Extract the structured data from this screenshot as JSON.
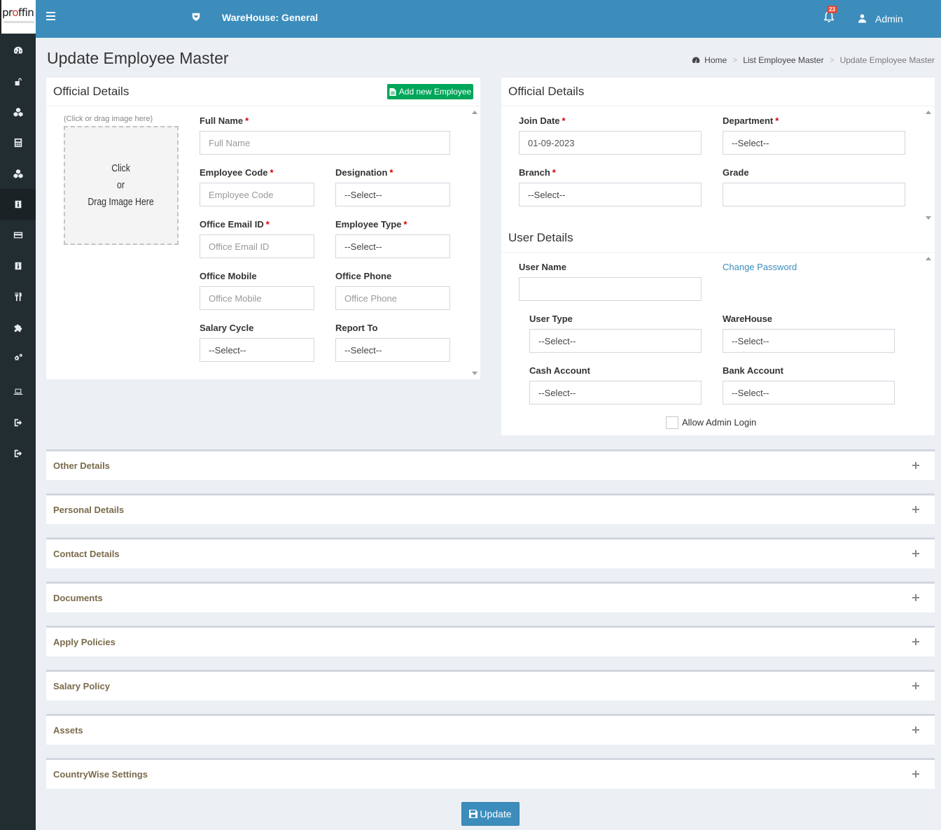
{
  "brand": {
    "logo": "proffin"
  },
  "sidebar": {
    "items": [
      {
        "icon": "dashboard-icon"
      },
      {
        "icon": "unlock-icon"
      },
      {
        "icon": "cubes-icon"
      },
      {
        "icon": "calculator-icon"
      },
      {
        "icon": "cubes-icon"
      },
      {
        "icon": "id-card-icon"
      },
      {
        "icon": "credit-card-icon"
      },
      {
        "icon": "id-badge-icon"
      },
      {
        "icon": "cutlery-icon"
      },
      {
        "icon": "puzzle-icon"
      },
      {
        "icon": "gears-icon"
      },
      {
        "icon": "laptop-icon"
      },
      {
        "icon": "sign-out-icon"
      },
      {
        "icon": "sign-out-icon"
      }
    ],
    "active_index": 5
  },
  "topbar": {
    "warehouse": "WareHouse: General",
    "notifications": "23",
    "user": "Admin"
  },
  "header": {
    "title": "Update Employee Master",
    "breadcrumb": {
      "home": "Home",
      "list": "List Employee Master",
      "current": "Update Employee Master"
    }
  },
  "left_panel": {
    "title": "Official Details",
    "add_button": "Add new Employee",
    "image_hint": "(Click or drag image here)",
    "image_drop": "Click\nor\nDrag Image Here",
    "full_name": {
      "label": "Full Name",
      "placeholder": "Full Name"
    },
    "employee_code": {
      "label": "Employee Code",
      "placeholder": "Employee Code"
    },
    "designation": {
      "label": "Designation",
      "value": "--Select--"
    },
    "office_email": {
      "label": "Office Email ID",
      "placeholder": "Office Email ID"
    },
    "employee_type": {
      "label": "Employee Type",
      "value": "--Select--"
    },
    "office_mobile": {
      "label": "Office Mobile",
      "placeholder": "Office Mobile"
    },
    "office_phone": {
      "label": "Office Phone",
      "placeholder": "Office Phone"
    },
    "salary_cycle": {
      "label": "Salary Cycle",
      "value": "--Select--"
    },
    "report_to": {
      "label": "Report To",
      "value": "--Select--"
    }
  },
  "right_panel": {
    "title": "Official Details",
    "join_date": {
      "label": "Join Date",
      "value": "01-09-2023"
    },
    "department": {
      "label": "Department",
      "value": "--Select--"
    },
    "branch": {
      "label": "Branch",
      "value": "--Select--"
    },
    "grade": {
      "label": "Grade",
      "value": ""
    }
  },
  "user_details": {
    "title": "User Details",
    "user_name": {
      "label": "User Name",
      "value": ""
    },
    "change_password": "Change Password",
    "user_type": {
      "label": "User Type",
      "value": "--Select--"
    },
    "warehouse": {
      "label": "WareHouse",
      "value": "--Select--"
    },
    "cash_account": {
      "label": "Cash Account",
      "value": "--Select--"
    },
    "bank_account": {
      "label": "Bank Account",
      "value": "--Select--"
    },
    "allow_admin_login": "Allow Admin Login"
  },
  "sections": [
    {
      "title": "Other Details"
    },
    {
      "title": "Personal Details"
    },
    {
      "title": "Contact Details"
    },
    {
      "title": "Documents"
    },
    {
      "title": "Apply Policies"
    },
    {
      "title": "Salary Policy"
    },
    {
      "title": "Assets"
    },
    {
      "title": "CountryWise Settings"
    }
  ],
  "update_button": "Update"
}
